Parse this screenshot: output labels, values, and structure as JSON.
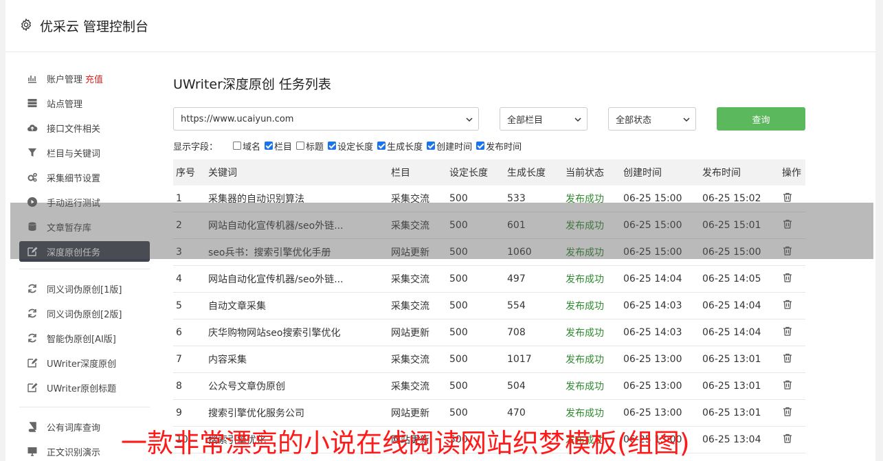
{
  "header": {
    "title": "优采云 管理控制台"
  },
  "sidebar": {
    "groups": [
      [
        {
          "label": "账户管理",
          "extra": "充值",
          "icon": "bar-chart-icon"
        },
        {
          "label": "站点管理",
          "icon": "server-icon"
        },
        {
          "label": "接口文件相关",
          "icon": "cloud-upload-icon"
        },
        {
          "label": "栏目与关键词",
          "icon": "filter-icon"
        },
        {
          "label": "采集细节设置",
          "icon": "cogs-icon"
        },
        {
          "label": "手动运行测试",
          "icon": "play-circle-icon"
        },
        {
          "label": "文章暂存库",
          "icon": "database-icon"
        },
        {
          "label": "深度原创任务",
          "icon": "edit-icon",
          "active": true
        }
      ],
      [
        {
          "label": "同义词伪原创[1版]",
          "icon": "refresh-icon"
        },
        {
          "label": "同义词伪原创[2版]",
          "icon": "refresh-icon"
        },
        {
          "label": "智能伪原创[AI版]",
          "icon": "refresh-icon"
        },
        {
          "label": "UWriter深度原创",
          "icon": "edit-icon"
        },
        {
          "label": "UWriter原创标题",
          "icon": "edit-icon"
        }
      ],
      [
        {
          "label": "公有词库查询",
          "icon": "book-icon"
        },
        {
          "label": "正文识别演示",
          "icon": "monitor-icon"
        }
      ]
    ]
  },
  "main": {
    "title": "UWriter深度原创 任务列表",
    "filters": {
      "site": "https://www.ucaiyun.com",
      "column": "全部栏目",
      "status": "全部状态",
      "query_label": "查询"
    },
    "fields": {
      "label": "显示字段：",
      "items": [
        {
          "label": "域名",
          "checked": false
        },
        {
          "label": "栏目",
          "checked": true
        },
        {
          "label": "标题",
          "checked": false
        },
        {
          "label": "设定长度",
          "checked": true
        },
        {
          "label": "生成长度",
          "checked": true
        },
        {
          "label": "创建时间",
          "checked": true
        },
        {
          "label": "发布时间",
          "checked": true
        }
      ]
    },
    "table": {
      "headers": [
        "序号",
        "关键词",
        "栏目",
        "设定长度",
        "生成长度",
        "当前状态",
        "创建时间",
        "发布时间",
        "操作"
      ],
      "rows": [
        [
          "1",
          "采集器的自动识别算法",
          "采集交流",
          "500",
          "533",
          "发布成功",
          "06-25 15:00",
          "06-25 15:02"
        ],
        [
          "2",
          "网站自动化宣传机器/seo外链...",
          "采集交流",
          "500",
          "601",
          "发布成功",
          "06-25 15:00",
          "06-25 15:01"
        ],
        [
          "3",
          "seo兵书：搜索引擎优化手册",
          "网站更新",
          "500",
          "1060",
          "发布成功",
          "06-25 15:00",
          "06-25 15:00"
        ],
        [
          "4",
          "网站自动化宣传机器/seo外链...",
          "采集交流",
          "500",
          "497",
          "发布成功",
          "06-25 14:04",
          "06-25 14:05"
        ],
        [
          "5",
          "自动文章采集",
          "采集交流",
          "500",
          "554",
          "发布成功",
          "06-25 14:03",
          "06-25 14:04"
        ],
        [
          "6",
          "庆华购物网站seo搜索引擎优化",
          "网站更新",
          "500",
          "708",
          "发布成功",
          "06-25 14:03",
          "06-25 14:04"
        ],
        [
          "7",
          "内容采集",
          "采集交流",
          "500",
          "1017",
          "发布成功",
          "06-25 13:00",
          "06-25 13:01"
        ],
        [
          "8",
          "公众号文章伪原创",
          "采集交流",
          "500",
          "504",
          "发布成功",
          "06-25 13:00",
          "06-25 13:01"
        ],
        [
          "9",
          "搜索引擎优化服务公司",
          "网站更新",
          "500",
          "470",
          "发布成功",
          "06-25 13:00",
          "06-25 13:01"
        ],
        [
          "10",
          "搜索引擎优化",
          "网站更新",
          "500",
          "",
          "发布成功",
          "06-25 13:00",
          "06-25 13:04"
        ]
      ]
    }
  },
  "watermark": {
    "text": "一款非常漂亮的小说在线阅读网站织梦模板(组图)"
  },
  "colors": {
    "accent_green": "#5cb85c",
    "active_nav": "#3e4350",
    "status_green": "#2e8b2e",
    "recharge_red": "#e02424",
    "watermark_red": "#ff1a1a"
  }
}
